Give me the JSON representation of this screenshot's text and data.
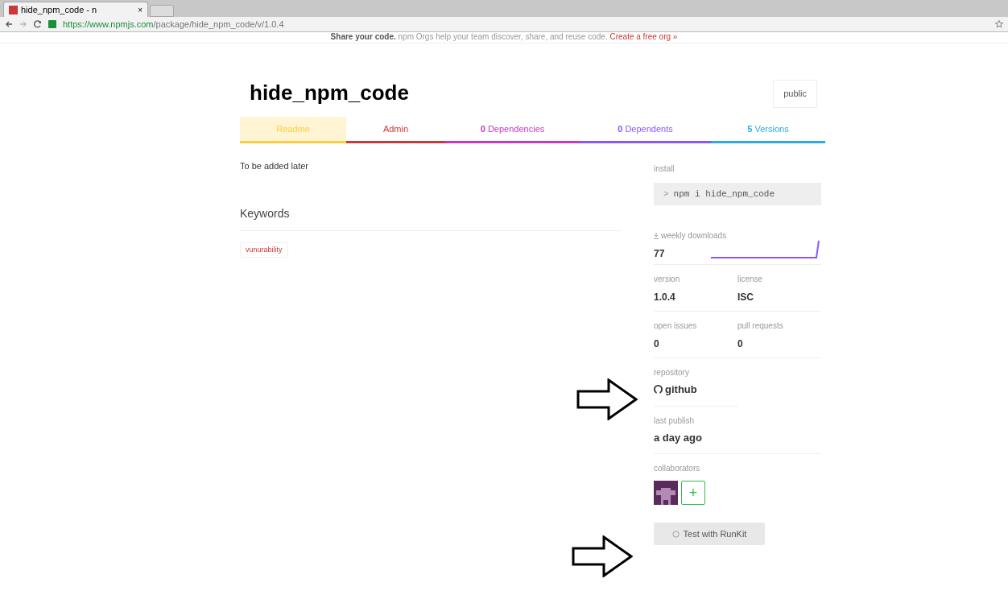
{
  "browser": {
    "tab_title": "hide_npm_code - n",
    "tab_close": "×",
    "url_host": "https://www.npmjs.com",
    "url_path": "/package/hide_npm_code/v/1.0.4"
  },
  "banner": {
    "text": "Share your code.",
    "detail": "npm Orgs help your team discover, share, and reuse code.",
    "link": "Create a free org »"
  },
  "package": {
    "name": "hide_npm_code",
    "visibility": "public"
  },
  "tabs": [
    {
      "label": "Readme",
      "color": "#ffcd3c",
      "selected": true
    },
    {
      "label": "Admin",
      "color": "#cb3837",
      "selected": false
    },
    {
      "label": "**0** Dependencies",
      "color": "#c836c3",
      "selected": false
    },
    {
      "label": "**0** Dependents",
      "color": "#8956ff",
      "selected": false
    },
    {
      "label": "**5** Versions",
      "color": "#29abe2",
      "selected": false
    }
  ],
  "readme": {
    "text": "To be added later",
    "keywords_heading": "Keywords",
    "keywords": [
      "vunurability"
    ]
  },
  "sidebar": {
    "install_label": "install",
    "install_prompt": ">",
    "install_command": "npm i hide_npm_code",
    "downloads_label": "weekly downloads",
    "downloads": "77",
    "version_label": "version",
    "version": "1.0.4",
    "license_label": "license",
    "license": "ISC",
    "issues_label": "open issues",
    "issues": "0",
    "pulls_label": "pull requests",
    "pulls": "0",
    "repository_label": "repository",
    "repository": "github",
    "publish_label": "last publish",
    "publish": "a day ago",
    "collaborators_label": "collaborators",
    "add_collaborator": "+",
    "runkit_button": "Test with RunKit"
  }
}
